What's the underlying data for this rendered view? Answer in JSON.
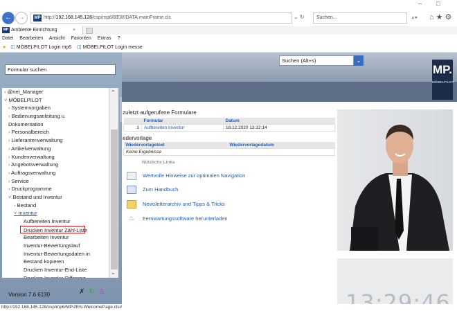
{
  "browser": {
    "url_prefix": "http://",
    "url_host": "192.168.145.128",
    "url_path": "/csp/mp6/BEWIDATA.mainFrame.cls",
    "search_placeholder": "Suchen...",
    "tab_title": "Ambiente Einrichtung",
    "menu": [
      "Datei",
      "Bearbeiten",
      "Ansicht",
      "Favoriten",
      "Extras",
      "?"
    ],
    "favorites": [
      "MÖBELPILOT Login mp6",
      "MÖBELPILOT Login messe"
    ],
    "status_url": "http://192.168.145.128/csp/mp6/MP.ZEN.WelcomePage.cls#"
  },
  "sidebar": {
    "search_placeholder": "Formular suchen",
    "tree": [
      {
        "label": "@net_Manager",
        "indent": 0,
        "prefix": "›"
      },
      {
        "label": "MÖBELPILOT",
        "indent": 0,
        "prefix": "˅"
      },
      {
        "label": "Systemvorgaben",
        "indent": 1,
        "prefix": "›"
      },
      {
        "label": "Bedienungsanleitung u.",
        "indent": 1,
        "prefix": "›"
      },
      {
        "label": "Dokumentation",
        "indent": 1,
        "prefix": ""
      },
      {
        "label": "Personalbereich",
        "indent": 1,
        "prefix": "›"
      },
      {
        "label": "Lieferantenverwaltung",
        "indent": 1,
        "prefix": "›"
      },
      {
        "label": "Artikelverwaltung",
        "indent": 1,
        "prefix": "›"
      },
      {
        "label": "Kundenverwaltung",
        "indent": 1,
        "prefix": "›"
      },
      {
        "label": "Angebotsverwaltung",
        "indent": 1,
        "prefix": "›"
      },
      {
        "label": "Auftragsverwaltung",
        "indent": 1,
        "prefix": "›"
      },
      {
        "label": "Service",
        "indent": 1,
        "prefix": "›"
      },
      {
        "label": "Druckprogramme",
        "indent": 1,
        "prefix": "›"
      },
      {
        "label": "Bestand und Inventur",
        "indent": 1,
        "prefix": "˅"
      },
      {
        "label": "Bestand",
        "indent": 2,
        "prefix": "›"
      },
      {
        "label": "Inventur",
        "indent": 2,
        "prefix": "˅",
        "style": "under"
      },
      {
        "label": "Aufbereiten Inventur",
        "indent": 3,
        "prefix": ""
      },
      {
        "label": "Drucken Inventur Zähl-Liste",
        "indent": 3,
        "prefix": "",
        "style": "boxed"
      },
      {
        "label": "Bearbeiten Inventur",
        "indent": 3,
        "prefix": ""
      },
      {
        "label": "Inventur-Bewertungslauf",
        "indent": 3,
        "prefix": ""
      },
      {
        "label": "Inventur-Bewertungsdaten in",
        "indent": 3,
        "prefix": ""
      },
      {
        "label": "Bestand kopieren",
        "indent": 3,
        "prefix": ""
      },
      {
        "label": "Drucken Inventur-End-Liste",
        "indent": 3,
        "prefix": ""
      },
      {
        "label": "Drucken Inventur-Differenz-",
        "indent": 3,
        "prefix": ""
      }
    ],
    "version": "Version 7.6 6130"
  },
  "main": {
    "search_placeholder": "Suchen (Alt+s)",
    "logo_text": "MP.",
    "logo_sub": "MÖBELPILOT",
    "recent_heading": "zuletzt aufgerufene Formulare",
    "recent_cols": [
      "Formular",
      "Datum"
    ],
    "recent_rows": [
      {
        "nr": "1",
        "formular": "Aufbereiten Inventur",
        "datum": "18.12.2020 13:12:14"
      }
    ],
    "wv_heading": "edervorlage",
    "wv_cols": [
      "Wiedervorlagetext",
      "Wiedervorlagedatum"
    ],
    "wv_empty": "Keine Ergebnisse",
    "useful_links": "Nützliche Links",
    "links": [
      "Wertvolle Hinweise zur optimalen Navigation",
      "Zum Handbuch",
      "Newsletterarchiv und Tipps & Tricks",
      "Fernwartungssoftware herunterladen"
    ],
    "clock": "13:29:46"
  }
}
